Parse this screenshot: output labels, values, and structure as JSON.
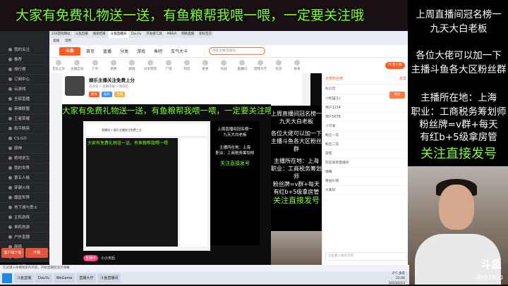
{
  "banner": {
    "text": "大家有免费礼物送一送，有鱼粮帮我喂一喂，一定要关注哦"
  },
  "overlay_right": {
    "line1": "上周直播间冠名榜一",
    "line2": "九天大白老板",
    "line3": "各位大佬可以加一下",
    "line4": "主播斗鱼各大区粉丝群",
    "line5": "主播所在地：上海",
    "line6": "职业：工商税务筹划师",
    "line7": "粉丝牌=v群+每天",
    "line8": "有红b+5级拿房管",
    "line9": "关注直接发号",
    "logo": "斗鱼",
    "count": "4097830"
  },
  "browser": {
    "tabs": [
      "234游戏网站",
      "斗鱼直播",
      "搜索结果",
      "斗鱼直播间",
      "DouYu",
      "开发者工具",
      "MBDA",
      "网络直播",
      "新标签页"
    ],
    "bookmarks": [
      "主页",
      "网址导航",
      "游戏中心",
      "直播",
      "常用"
    ]
  },
  "nav": {
    "logo": "斗鱼",
    "items": [
      "首页",
      "直播",
      "分类",
      "游戏",
      "鱼吧",
      "车气大卡"
    ],
    "search_placeholder": "搜索主播/直播间"
  },
  "categories": [
    "音乐之声",
    "主播互动",
    "户外",
    "新秀",
    "颜值",
    "分享赞赏",
    "广场",
    "附近",
    "星秀",
    "对战",
    "直播间",
    "游戏大厅",
    "综合",
    "体育"
  ],
  "pc_button": "PC客户端",
  "sidebar": {
    "items": [
      "我的关注",
      "推荐",
      "排行榜",
      "订阅中心",
      "云游戏",
      "全部直播",
      "英雄联盟",
      "王者荣耀",
      "和平精英",
      "CS:GO",
      "原神",
      "绝地求生",
      "我的世界",
      "第五人格",
      "穿越火线",
      "魔兽世界",
      "地下城与勇士",
      "主机游戏",
      "单机热游",
      "户外直播",
      "颜值",
      "星秀",
      "二次元"
    ],
    "btn1": "客户端下载",
    "btn2": "开播"
  },
  "room": {
    "title": "娱乐主播关注免费上分",
    "meta": "房间号 • 主播等级 • 颜值区",
    "tags": [
      "星秀",
      "娱乐",
      "直播"
    ]
  },
  "inner": {
    "header": "直播间 • 娱乐主播关注免费上分",
    "green": "大家有免费礼物送一送，有鱼粮帮我喂一喂",
    "col_l1": "上周直播间冠名榜一",
    "col_l2": "九天大白老板",
    "col_l3": "主播所在地：上海",
    "col_l4": "职业：工商税务筹划师",
    "col_l5": "关注直接发号",
    "bottom_badge": "直播中",
    "bottom_text": "小小天后"
  },
  "center_col": {
    "l1": "上周直播间冠名榜一",
    "l2": "九天大白老板",
    "l3": "各位大佬可以加一下",
    "l4": "主播斗鱼各大区粉丝群",
    "l5": "主播所在地：上海",
    "l6": "职业：工商税务筹划师",
    "l7": "粉丝牌=v群+每天",
    "l8": "有红b+5级拿房管",
    "l9": "关注直接发号"
  },
  "chat": {
    "head_left": "全部粉丝榜",
    "head_right": "贵宾",
    "sub": "粉丝团",
    "follow": "关注",
    "rows": [
      "小熊猫(1)",
      "用户1234",
      "用户5678",
      "小可爱",
      "粉丝一号",
      "粉丝二号",
      "游客",
      "欢迎来到直播间",
      "弹幕",
      "赠送礼物",
      "大家好"
    ],
    "input_placeholder": "这里输入聊天内容"
  },
  "statusbar": "在此键入你要搜索的内容，开始直播后显示弹幕",
  "taskbar": {
    "items": [
      "斗鱼直播",
      "DouYu",
      "WeGame",
      "直播大厅",
      "斗鱼直播间"
    ],
    "tray_time": "22:06",
    "tray_date": "2023/2/13",
    "tray_weather": "3°C 多云"
  }
}
